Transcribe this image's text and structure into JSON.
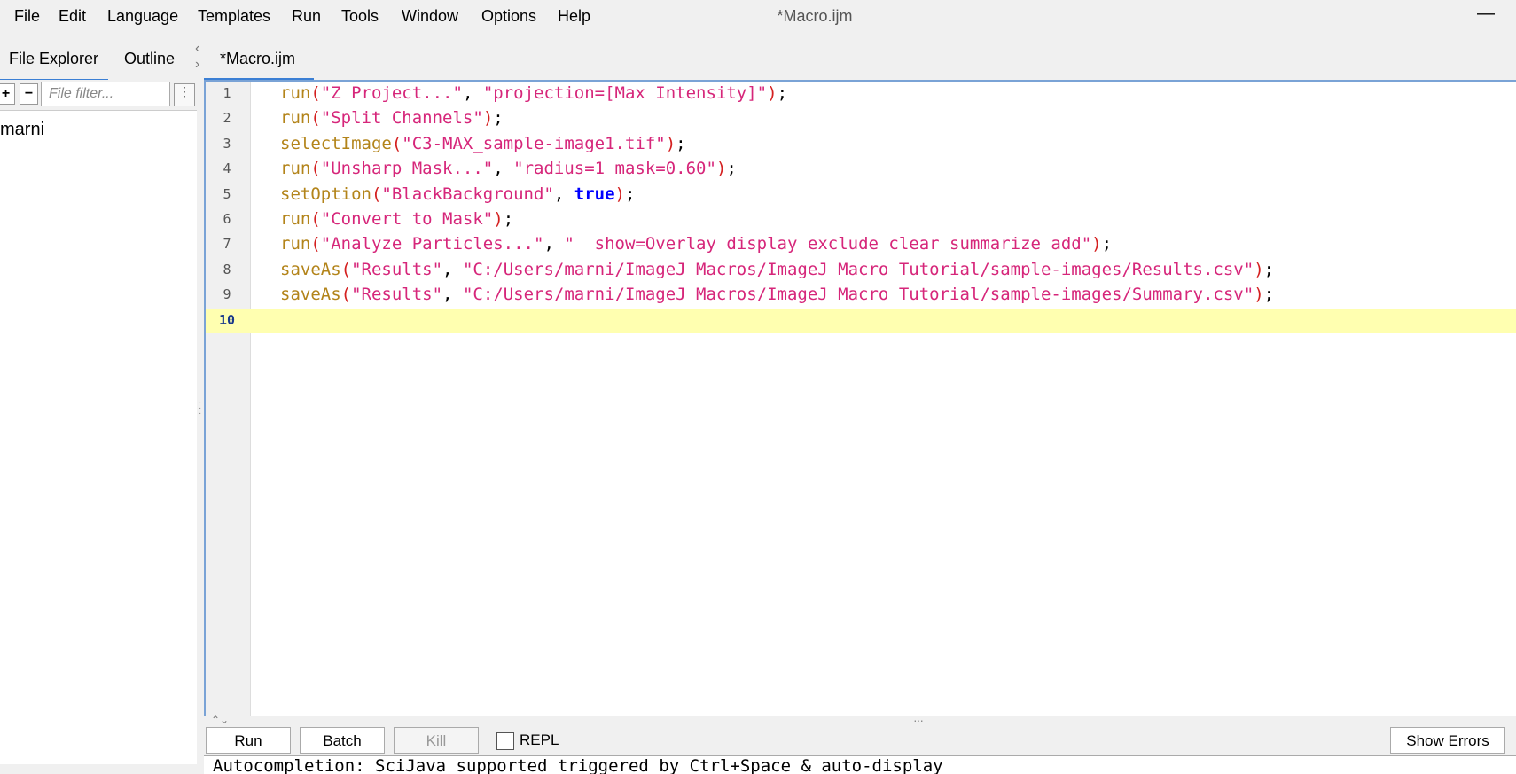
{
  "window": {
    "title": "*Macro.ijm",
    "minimize_glyph": "—"
  },
  "menu": [
    "File",
    "Edit",
    "Language",
    "Templates",
    "Run",
    "Tools",
    "Window",
    "Options",
    "Help"
  ],
  "sidebar": {
    "tabs": [
      "File Explorer",
      "Outline"
    ],
    "add_label": "+",
    "remove_label": "−",
    "filter_placeholder": "File filter...",
    "more_label": "⋮",
    "tree_items": [
      "marni"
    ]
  },
  "editor": {
    "tab_label": "*Macro.ijm",
    "current_line": 10,
    "lines": [
      [
        [
          "fn",
          "run"
        ],
        [
          "par",
          "("
        ],
        [
          "str",
          "\"Z Project...\""
        ],
        [
          "pun",
          ", "
        ],
        [
          "str",
          "\"projection=[Max Intensity]\""
        ],
        [
          "par",
          ")"
        ],
        [
          "pun",
          ";"
        ]
      ],
      [
        [
          "fn",
          "run"
        ],
        [
          "par",
          "("
        ],
        [
          "str",
          "\"Split Channels\""
        ],
        [
          "par",
          ")"
        ],
        [
          "pun",
          ";"
        ]
      ],
      [
        [
          "fn",
          "selectImage"
        ],
        [
          "par",
          "("
        ],
        [
          "str",
          "\"C3-MAX_sample-image1.tif\""
        ],
        [
          "par",
          ")"
        ],
        [
          "pun",
          ";"
        ]
      ],
      [
        [
          "fn",
          "run"
        ],
        [
          "par",
          "("
        ],
        [
          "str",
          "\"Unsharp Mask...\""
        ],
        [
          "pun",
          ", "
        ],
        [
          "str",
          "\"radius=1 mask=0.60\""
        ],
        [
          "par",
          ")"
        ],
        [
          "pun",
          ";"
        ]
      ],
      [
        [
          "fn",
          "setOption"
        ],
        [
          "par",
          "("
        ],
        [
          "str",
          "\"BlackBackground\""
        ],
        [
          "pun",
          ", "
        ],
        [
          "kw",
          "true"
        ],
        [
          "par",
          ")"
        ],
        [
          "pun",
          ";"
        ]
      ],
      [
        [
          "fn",
          "run"
        ],
        [
          "par",
          "("
        ],
        [
          "str",
          "\"Convert to Mask\""
        ],
        [
          "par",
          ")"
        ],
        [
          "pun",
          ";"
        ]
      ],
      [
        [
          "fn",
          "run"
        ],
        [
          "par",
          "("
        ],
        [
          "str",
          "\"Analyze Particles...\""
        ],
        [
          "pun",
          ", "
        ],
        [
          "str",
          "\"  show=Overlay display exclude clear summarize add\""
        ],
        [
          "par",
          ")"
        ],
        [
          "pun",
          ";"
        ]
      ],
      [
        [
          "fn",
          "saveAs"
        ],
        [
          "par",
          "("
        ],
        [
          "str",
          "\"Results\""
        ],
        [
          "pun",
          ", "
        ],
        [
          "str",
          "\"C:/Users/marni/ImageJ Macros/ImageJ Macro Tutorial/sample-images/Results.csv\""
        ],
        [
          "par",
          ")"
        ],
        [
          "pun",
          ";"
        ]
      ],
      [
        [
          "fn",
          "saveAs"
        ],
        [
          "par",
          "("
        ],
        [
          "str",
          "\"Results\""
        ],
        [
          "pun",
          ", "
        ],
        [
          "str",
          "\"C:/Users/marni/ImageJ Macros/ImageJ Macro Tutorial/sample-images/Summary.csv\""
        ],
        [
          "par",
          ")"
        ],
        [
          "pun",
          ";"
        ]
      ],
      []
    ]
  },
  "buttons": {
    "run": "Run",
    "batch": "Batch",
    "kill": "Kill",
    "repl": "REPL",
    "show_errors": "Show Errors"
  },
  "console": {
    "text": "Autocompletion: SciJava supported triggered by Ctrl+Space & auto-display"
  }
}
